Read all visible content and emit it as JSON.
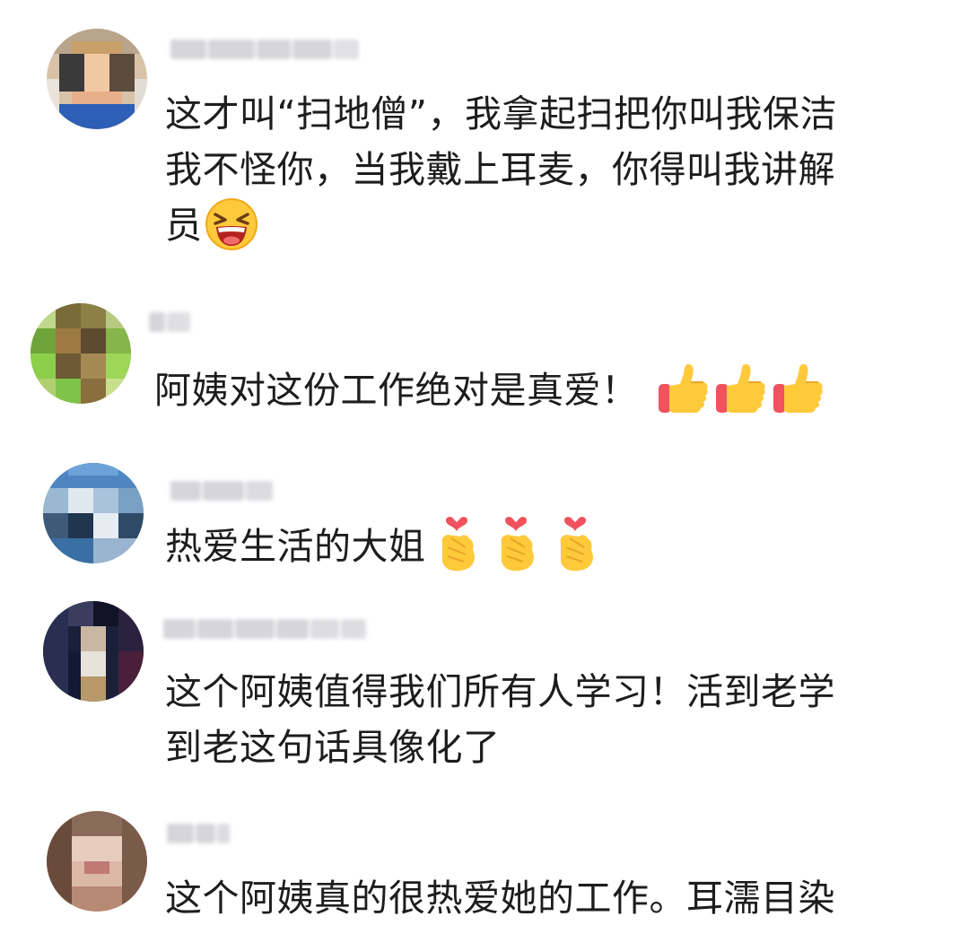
{
  "comments": [
    {
      "lines": [
        "这才叫“扫地僧”，我拿起扫把你叫我保洁",
        "我不怪你，当我戴上耳麦，你得叫我讲解",
        "员"
      ],
      "emoji": "laughing-squint-emoji",
      "emoji_count": 1
    },
    {
      "lines": [
        "阿姨对这份工作绝对是真爱！"
      ],
      "emoji": "thumbs-up-emoji",
      "emoji_count": 3
    },
    {
      "lines": [
        "热爱生活的大姐"
      ],
      "emoji": "finger-heart-emoji",
      "emoji_count": 3
    },
    {
      "lines": [
        "这个阿姨值得我们所有人学习！活到老学",
        "到老这句话具像化了"
      ],
      "emoji": "",
      "emoji_count": 0
    },
    {
      "lines": [
        "这个阿姨真的很热爱她的工作。耳濡目染"
      ],
      "emoji": "",
      "emoji_count": 0
    }
  ],
  "colors": {
    "text": "#1d1d1f",
    "background": "#ffffff",
    "emoji_yellow": "#ffc93c",
    "emoji_red": "#f0525e"
  }
}
